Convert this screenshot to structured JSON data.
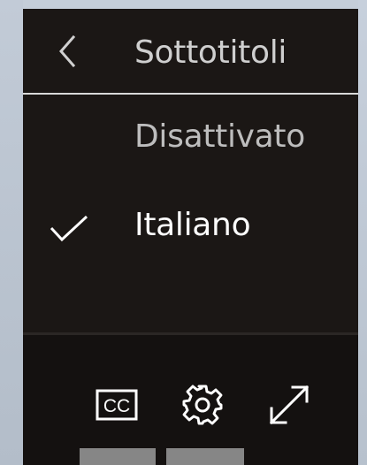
{
  "menu": {
    "title": "Sottotitoli",
    "back_icon": "chevron-left-icon",
    "options": [
      {
        "label": "Disattivato",
        "selected": false
      },
      {
        "label": "Italiano",
        "selected": true,
        "icon": "check-icon"
      }
    ]
  },
  "controls": {
    "items": [
      {
        "name": "closed-captions",
        "icon": "cc-icon"
      },
      {
        "name": "settings",
        "icon": "gear-icon"
      },
      {
        "name": "fullscreen",
        "icon": "expand-diagonal-icon"
      }
    ]
  },
  "colors": {
    "panel_bg": "#1b1715",
    "controls_bg": "#141110",
    "text_selected": "#ffffff",
    "text_unselected": "#bdbdbd",
    "divider": "#d9d9d9",
    "backdrop": "#bcc6d2"
  }
}
